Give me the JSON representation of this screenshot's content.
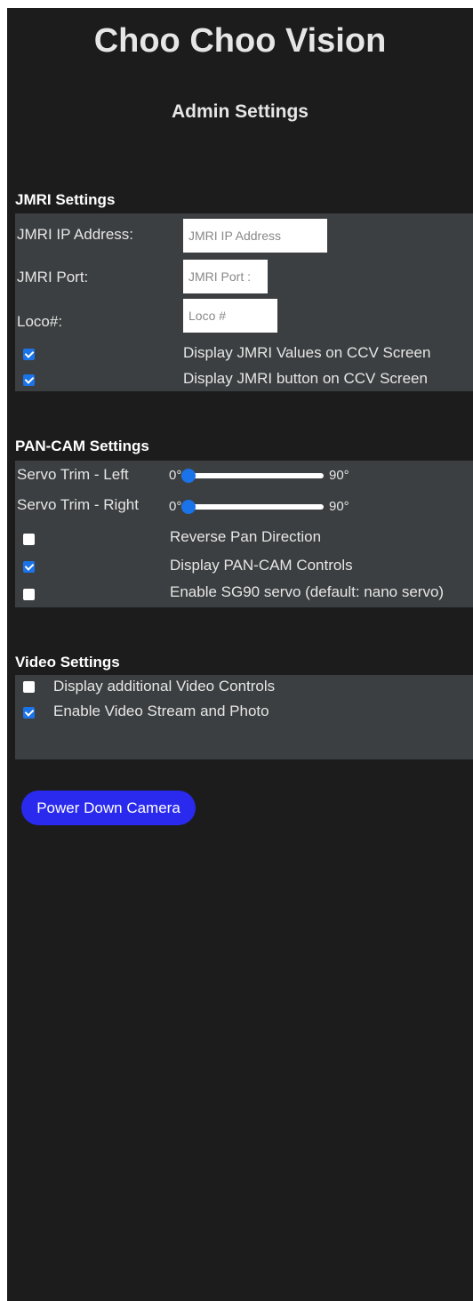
{
  "header": {
    "title": "Choo Choo Vision",
    "subtitle": "Admin Settings"
  },
  "jmri": {
    "heading": "JMRI Settings",
    "ip_label": "JMRI IP Address:",
    "ip_placeholder": "JMRI IP Address",
    "port_label": "JMRI Port:",
    "port_placeholder": "JMRI Port :",
    "loco_label": "Loco#:",
    "loco_placeholder": "Loco #",
    "display_values": {
      "label": "Display JMRI Values on CCV Screen",
      "checked": true
    },
    "display_button": {
      "label": "Display JMRI button on CCV Screen",
      "checked": true
    }
  },
  "pancam": {
    "heading": "PAN-CAM Settings",
    "trim_left": {
      "label": "Servo Trim - Left",
      "min_label": "0°",
      "max_label": "90°",
      "value": 0
    },
    "trim_right": {
      "label": "Servo Trim - Right",
      "min_label": "0°",
      "max_label": "90°",
      "value": 0
    },
    "reverse_pan": {
      "label": "Reverse Pan Direction",
      "checked": false
    },
    "display_controls": {
      "label": "Display PAN-CAM Controls",
      "checked": true
    },
    "enable_sg90": {
      "label": "Enable SG90 servo (default: nano servo)",
      "checked": false
    }
  },
  "video": {
    "heading": "Video Settings",
    "additional_controls": {
      "label": "Display additional Video Controls",
      "checked": false
    },
    "enable_stream": {
      "label": "Enable Video Stream and Photo",
      "checked": true
    }
  },
  "actions": {
    "power_down_label": "Power Down Camera"
  },
  "colors": {
    "background": "#1c1c1c",
    "panel": "#3c3f41",
    "accent": "#1a73e8",
    "button": "#2a2aef"
  }
}
